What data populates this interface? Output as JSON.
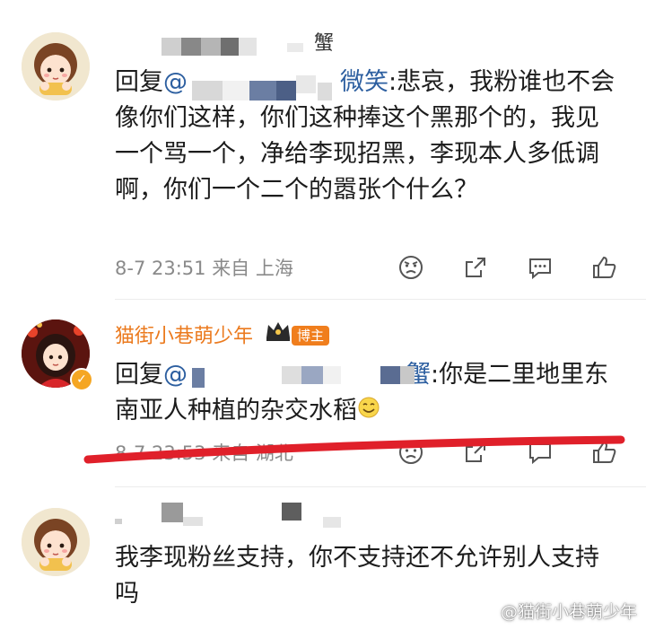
{
  "comments": [
    {
      "name_suffix": "蟹",
      "reply_prefix": "回复",
      "at_prefix": "@",
      "at_suffix": "微笑",
      "text": ":悲哀，我粉谁也不会像你们这样，你们这种捧这个黑那个的，我见一个骂一个，净给李现招黑，李现本人多低调啊，你们一个二个的嚣张个什么？",
      "time": "8-7 23:51",
      "location": "来自 上海"
    },
    {
      "name": "猫街小巷萌少年",
      "host_tag": "博主",
      "reply_prefix": "回复",
      "at_prefix": "@",
      "at_suffix": "蟹",
      "text": ":你是二里地里东南亚人种植的杂交水稻",
      "time": "8-7 23:53",
      "location": "来自 湖北"
    },
    {
      "text": "我李现粉丝支持，你不支持还不允许别人支持吗"
    }
  ],
  "watermark": "@猫街小巷萌少年",
  "colors": {
    "accent_name": "#eb7a1e",
    "at_link": "#2d5fa0",
    "annotation_red": "#e0202a"
  },
  "icons": [
    "angry-icon",
    "share-icon",
    "comment-icon",
    "like-icon"
  ]
}
